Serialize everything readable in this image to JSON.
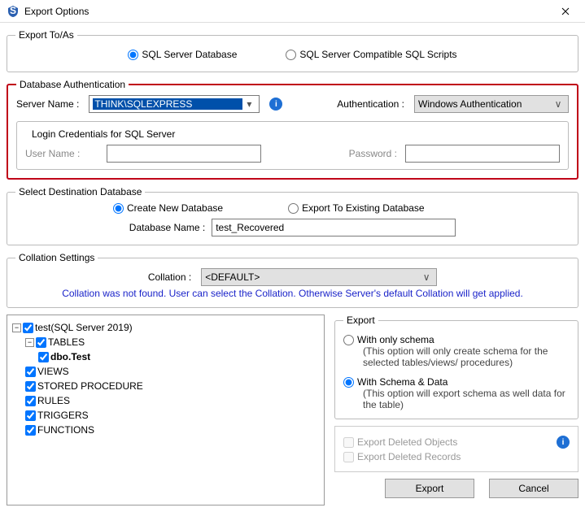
{
  "window": {
    "title": "Export Options"
  },
  "exportTo": {
    "legend": "Export To/As",
    "optDb": "SQL Server Database",
    "optScripts": "SQL Server Compatible SQL Scripts"
  },
  "auth": {
    "legend": "Database Authentication",
    "serverLabel": "Server Name :",
    "serverValue": "THINK\\SQLEXPRESS",
    "authLabel": "Authentication :",
    "authValue": "Windows Authentication",
    "credsLegend": "Login Credentials for SQL Server",
    "userLabel": "User Name :",
    "userValue": "",
    "passLabel": "Password :",
    "passValue": ""
  },
  "dest": {
    "legend": "Select Destination Database",
    "optNew": "Create New Database",
    "optExisting": "Export To Existing Database",
    "dbNameLabel": "Database Name :",
    "dbNameValue": "test_Recovered"
  },
  "coll": {
    "legend": "Collation Settings",
    "label": "Collation :",
    "value": "<DEFAULT>",
    "note": "Collation was not found. User can select the Collation. Otherwise Server's default Collation will get applied."
  },
  "tree": {
    "root": "test(SQL Server 2019)",
    "tables": "TABLES",
    "dboTest": "dbo.Test",
    "views": "VIEWS",
    "sp": "STORED PROCEDURE",
    "rules": "RULES",
    "trig": "TRIGGERS",
    "func": "FUNCTIONS"
  },
  "export": {
    "legend": "Export",
    "optSchema": "With only schema",
    "schemaDesc": "(This option will only create schema for the  selected tables/views/ procedures)",
    "optData": "With Schema & Data",
    "dataDesc": "(This option will export schema as well data for the table)",
    "chkDelObj": "Export Deleted Objects",
    "chkDelRec": "Export Deleted Records",
    "btnExport": "Export",
    "btnCancel": "Cancel"
  }
}
